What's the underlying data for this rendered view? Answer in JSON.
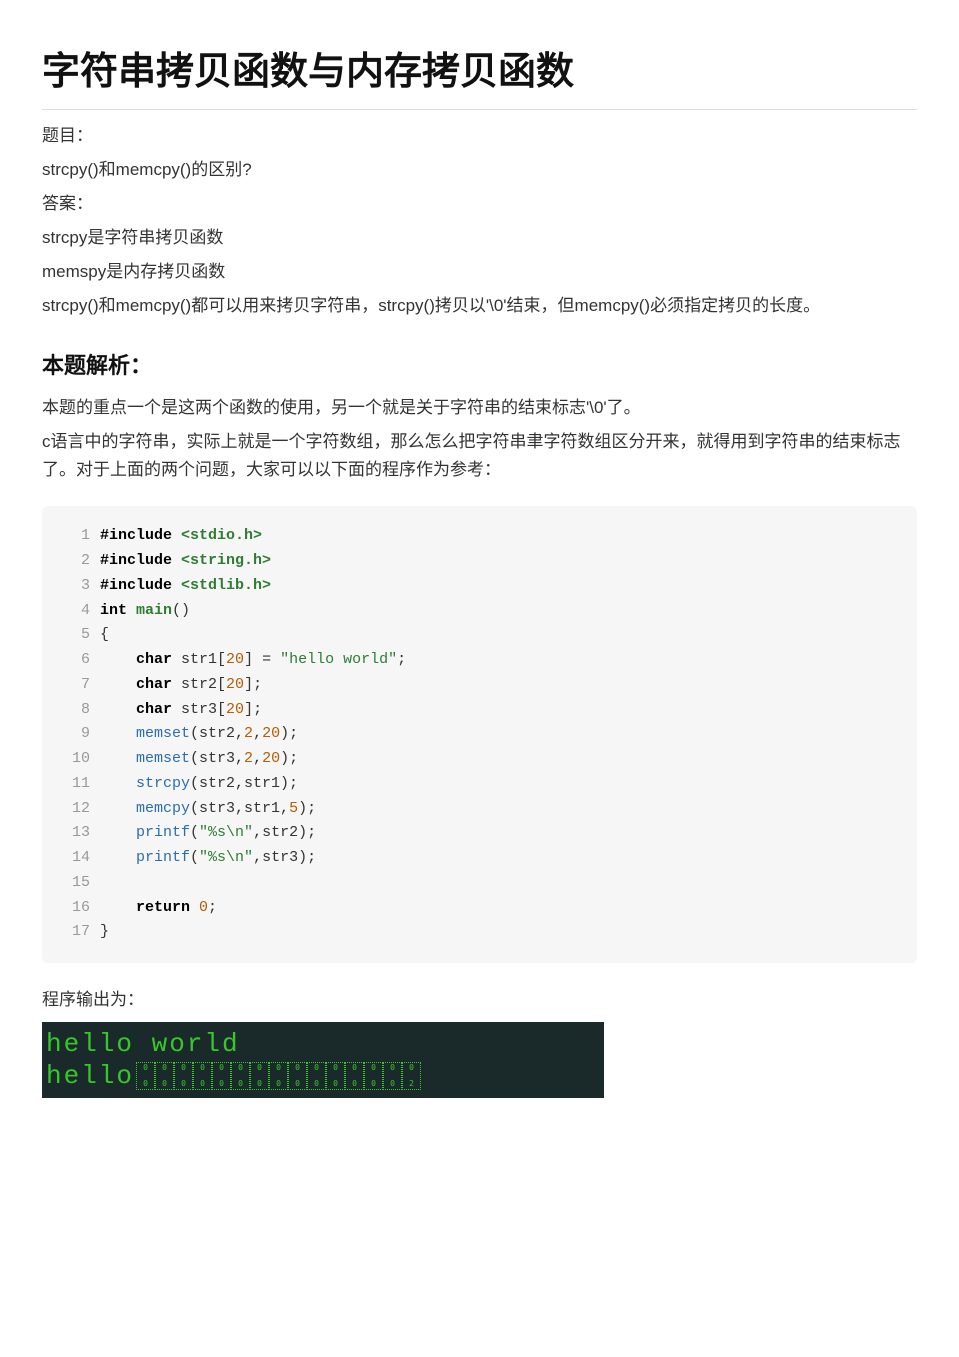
{
  "title": "字符串拷贝函数与内存拷贝函数",
  "intro": {
    "l1": "题目：",
    "l2": "strcpy()和memcpy()的区别?",
    "l3": "答案：",
    "l4": "strcpy是字符串拷贝函数",
    "l5": "memspy是内存拷贝函数",
    "l6": "strcpy()和memcpy()都可以用来拷贝字符串，strcpy()拷贝以'\\0'结束，但memcpy()必须指定拷贝的长度。"
  },
  "section": "本题解析：",
  "analysis": {
    "p1": "本题的重点一个是这两个函数的使用，另一个就是关于字符串的结束标志'\\0'了。",
    "p2": "c语言中的字符串，实际上就是一个字符数组，那么怎么把字符串聿字符数组区分开来，就得用到字符串的结束标志了。对于上面的两个问题，大家可以以下面的程序作为参考："
  },
  "code": {
    "l1": {
      "num": "1",
      "directive": "#include ",
      "hdr": "<stdio.h>"
    },
    "l2": {
      "num": "2",
      "directive": "#include ",
      "hdr": "<string.h>"
    },
    "l3": {
      "num": "3",
      "directive": "#include ",
      "hdr": "<stdlib.h>"
    },
    "l4": {
      "num": "4",
      "kw1": "int ",
      "fn": "main",
      "rest": "()"
    },
    "l5": {
      "num": "5",
      "text": "{"
    },
    "l6": {
      "num": "6",
      "indent": "    ",
      "kw": "char ",
      "rest1": "str1[",
      "n": "20",
      "rest2": "] = ",
      "str": "\"hello world\"",
      "tail": ";"
    },
    "l7": {
      "num": "7",
      "indent": "    ",
      "kw": "char ",
      "rest1": "str2[",
      "n": "20",
      "rest2": "];"
    },
    "l8": {
      "num": "8",
      "indent": "    ",
      "kw": "char ",
      "rest1": "str3[",
      "n": "20",
      "rest2": "];"
    },
    "l9": {
      "num": "9",
      "indent": "    ",
      "call": "memset",
      "args": "(str2,",
      "n1": "2",
      "c": ",",
      "n2": "20",
      "tail": ");"
    },
    "l10": {
      "num": "10",
      "indent": "    ",
      "call": "memset",
      "args": "(str3,",
      "n1": "2",
      "c": ",",
      "n2": "20",
      "tail": ");"
    },
    "l11": {
      "num": "11",
      "indent": "    ",
      "call": "strcpy",
      "args": "(str2,str1);"
    },
    "l12": {
      "num": "12",
      "indent": "    ",
      "call": "memcpy",
      "args": "(str3,str1,",
      "n": "5",
      "tail": ");"
    },
    "l13": {
      "num": "13",
      "indent": "    ",
      "call": "printf",
      "open": "(",
      "str": "\"%s\\n\"",
      "rest": ",str2);"
    },
    "l14": {
      "num": "14",
      "indent": "    ",
      "call": "printf",
      "open": "(",
      "str": "\"%s\\n\"",
      "rest": ",str3);"
    },
    "l15": {
      "num": "15",
      "text": ""
    },
    "l16": {
      "num": "16",
      "indent": "    ",
      "kw": "return ",
      "n": "0",
      "tail": ";"
    },
    "l17": {
      "num": "17",
      "text": "}"
    }
  },
  "outlabel": "程序输出为：",
  "terminal": {
    "line1": "hello world",
    "line2": "hello",
    "garbage": [
      {
        "t": "0",
        "b": "0"
      },
      {
        "t": "0",
        "b": "0"
      },
      {
        "t": "0",
        "b": "0"
      },
      {
        "t": "0",
        "b": "0"
      },
      {
        "t": "0",
        "b": "0"
      },
      {
        "t": "0",
        "b": "0"
      },
      {
        "t": "0",
        "b": "0"
      },
      {
        "t": "0",
        "b": "0"
      },
      {
        "t": "0",
        "b": "0"
      },
      {
        "t": "0",
        "b": "0"
      },
      {
        "t": "0",
        "b": "0"
      },
      {
        "t": "0",
        "b": "0"
      },
      {
        "t": "0",
        "b": "0"
      },
      {
        "t": "0",
        "b": "0"
      },
      {
        "t": "0",
        "b": "2"
      }
    ]
  }
}
